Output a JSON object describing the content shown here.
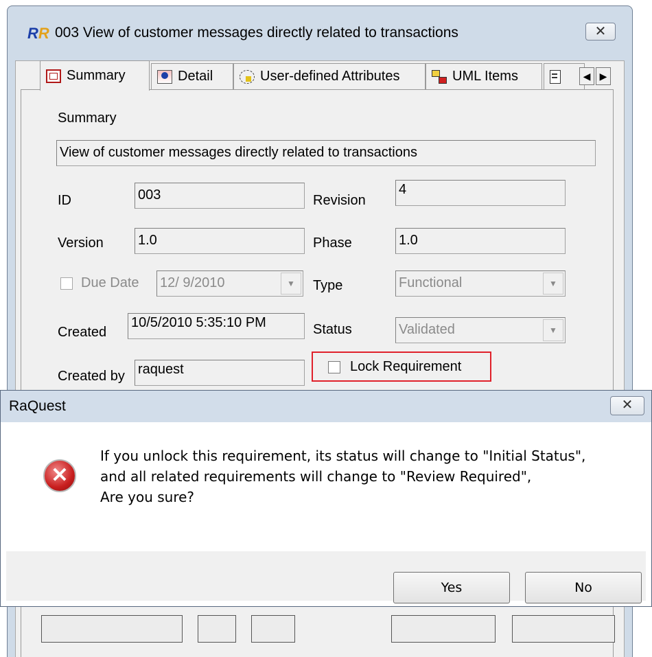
{
  "main_window": {
    "logo": "RR",
    "title": "003 View of customer messages directly related to transactions",
    "close_icon": "close-icon"
  },
  "tabs": [
    {
      "label": "Summary",
      "icon": "summary-icon",
      "active": true
    },
    {
      "label": "Detail",
      "icon": "detail-icon",
      "active": false
    },
    {
      "label": "User-defined Attributes",
      "icon": "attributes-icon",
      "active": false
    },
    {
      "label": "UML Items",
      "icon": "uml-items-icon",
      "active": false
    }
  ],
  "tab_scroll": {
    "left": "◀",
    "right": "▶"
  },
  "summary": {
    "section_label": "Summary",
    "summary_value": "View of customer messages directly related to transactions",
    "id_label": "ID",
    "id_value": "003",
    "revision_label": "Revision",
    "revision_value": "4",
    "version_label": "Version",
    "version_value": "1.0",
    "phase_label": "Phase",
    "phase_value": "1.0",
    "due_date_label": "Due Date",
    "due_date_value": "12/ 9/2010",
    "type_label": "Type",
    "type_value": "Functional",
    "created_label": "Created",
    "created_value": "10/5/2010 5:35:10 PM",
    "status_label": "Status",
    "status_value": "Validated",
    "created_by_label": "Created by",
    "created_by_value": "raquest",
    "lock_label": "Lock Requirement",
    "lock_checked": false
  },
  "dialog": {
    "title": "RaQuest",
    "close_icon": "close-icon",
    "icon": "error-icon",
    "message_lines": [
      "If you unlock this requirement, its status will change to \"Initial Status\",",
      "and all related requirements will change to \"Review Required\",",
      "Are you sure?"
    ],
    "yes_label": "Yes",
    "no_label": "No"
  },
  "colors": {
    "title_bar": "#cfdbe8",
    "highlight": "#e0202a",
    "error_red": "#c81e1e"
  }
}
